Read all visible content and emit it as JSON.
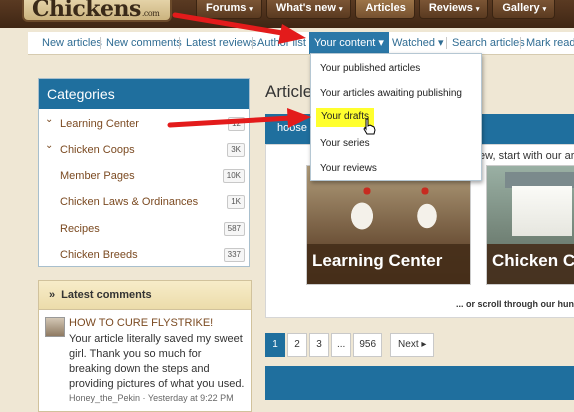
{
  "site": {
    "logo_text": "Chickens",
    "logo_suffix": ".com"
  },
  "topnav": [
    {
      "label": "Forums",
      "caret": "▾"
    },
    {
      "label": "What's new",
      "caret": "▾"
    },
    {
      "label": "Articles",
      "caret": ""
    },
    {
      "label": "Reviews",
      "caret": "▾"
    },
    {
      "label": "Gallery",
      "caret": "▾"
    }
  ],
  "subnav": [
    {
      "label": "New articles"
    },
    {
      "label": "New comments"
    },
    {
      "label": "Latest reviews"
    },
    {
      "label": "Author list"
    },
    {
      "label": "Your content ▾"
    },
    {
      "label": "Watched ▾"
    },
    {
      "label": "Search articles"
    },
    {
      "label": "Mark read"
    }
  ],
  "dropdown": [
    {
      "label": "Your published articles"
    },
    {
      "label": "Your articles awaiting publishing"
    },
    {
      "label": "Your drafts"
    },
    {
      "label": "Your series"
    },
    {
      "label": "Your reviews"
    }
  ],
  "categories": {
    "title": "Categories",
    "items": [
      {
        "label": "Learning Center",
        "count": "12",
        "arrow": "⌄"
      },
      {
        "label": "Chicken Coops",
        "count": "3K",
        "arrow": "⌄"
      },
      {
        "label": "Member Pages",
        "count": "10K",
        "arrow": ""
      },
      {
        "label": "Chicken Laws & Ordinances",
        "count": "1K",
        "arrow": ""
      },
      {
        "label": "Recipes",
        "count": "587",
        "arrow": ""
      },
      {
        "label": "Chicken Breeds",
        "count": "337",
        "arrow": ""
      }
    ]
  },
  "latest_comments": {
    "title": "Latest comments",
    "chevron": "»",
    "item": {
      "title": "HOW TO CURE FLYSTRIKE!",
      "body": "Your article literally saved my sweet girl. Thank you so much for breaking down the steps and providing pictures of what you used.",
      "meta": "Honey_the_Pekin · Yesterday at 9:22 PM"
    }
  },
  "main": {
    "heading": "Article",
    "band_text": "hoose",
    "intro": "ew, start with our art",
    "cards": [
      {
        "title": "Learning Center"
      },
      {
        "title": "Chicken C"
      }
    ],
    "scroll_note": "... or scroll through our hun",
    "pager": {
      "pages": [
        "1",
        "2",
        "3",
        "...",
        "956"
      ],
      "next": "Next ▸"
    }
  },
  "colors": {
    "accent": "#1f6f9e",
    "link": "#7b4a21",
    "highlight": "#ffff2e",
    "annotation_arrow": "#e31b1b"
  },
  "icons": {
    "annotation": "red-arrow-icon",
    "cursor": "hand-pointer-icon"
  }
}
